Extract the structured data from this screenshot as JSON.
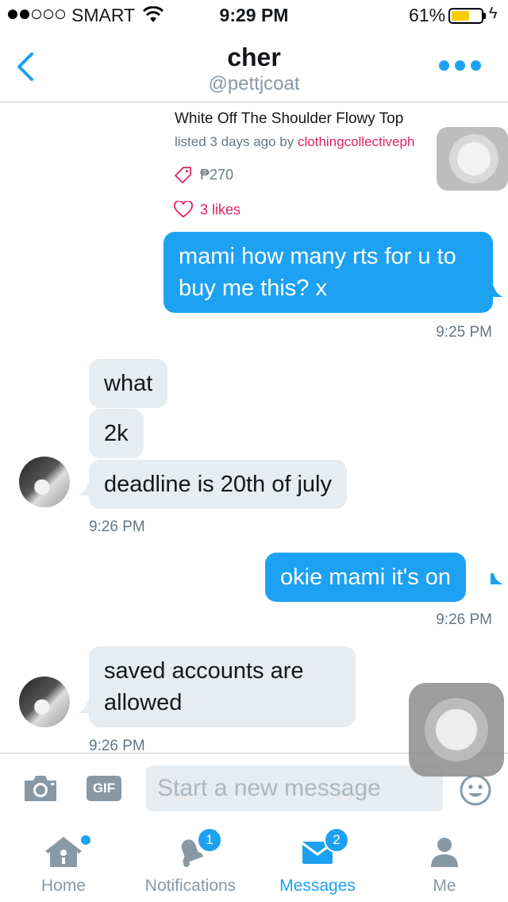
{
  "status_bar": {
    "carrier": "SMART",
    "time": "9:29 PM",
    "battery_percent": "61%",
    "battery_level": 0.61,
    "signal_bars_filled": 2
  },
  "nav": {
    "name": "cher",
    "handle": "@pettjcoat"
  },
  "product": {
    "title": "White Off The Shoulder Flowy Top",
    "listed_prefix": "listed 3 days ago by ",
    "seller": "clothingcollectiveph",
    "price": "₱270",
    "likes": "3 likes"
  },
  "messages": {
    "out1": "mami how many rts for u to buy me this? x",
    "ts1": "9:25 PM",
    "in1": "what",
    "in2": "2k",
    "in3": "deadline is 20th of july",
    "ts2": "9:26 PM",
    "out2": "okie mami it's on",
    "ts3": "9:26 PM",
    "in4": "saved accounts are allowed",
    "ts4": "9:26 PM"
  },
  "composer": {
    "gif_label": "GIF",
    "placeholder": "Start a new message"
  },
  "tabs": {
    "home": "Home",
    "notifications": "Notifications",
    "notifications_badge": "1",
    "messages": "Messages",
    "messages_badge": "2",
    "me": "Me"
  },
  "colors": {
    "accent": "#1da1f2",
    "like": "#e0245e",
    "incoming_bubble": "#e6ecf0"
  },
  "icons": [
    "back-chevron-icon",
    "more-icon",
    "price-tag-icon",
    "heart-icon",
    "camera-icon",
    "emoji-icon",
    "home-icon",
    "bell-icon",
    "envelope-icon",
    "person-icon",
    "wifi-icon",
    "battery-icon"
  ]
}
